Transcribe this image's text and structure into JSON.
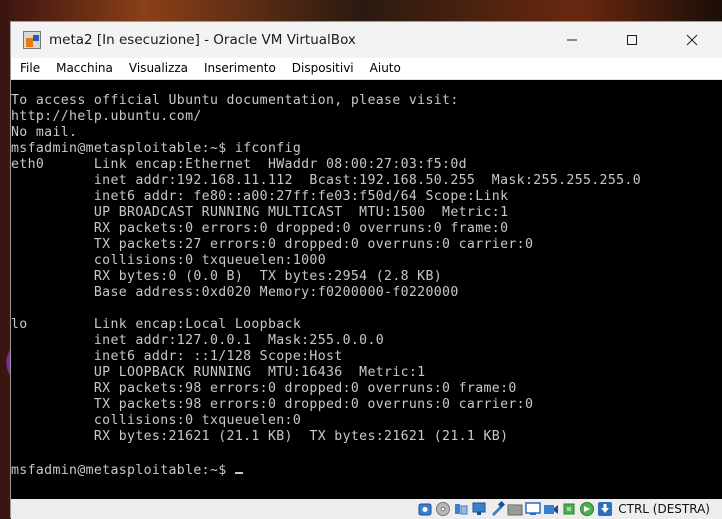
{
  "window": {
    "title": "meta2 [In esecuzione] - Oracle VM VirtualBox"
  },
  "menu": [
    {
      "label": "File"
    },
    {
      "label": "Macchina"
    },
    {
      "label": "Visualizza"
    },
    {
      "label": "Inserimento"
    },
    {
      "label": "Dispositivi"
    },
    {
      "label": "Aiuto"
    }
  ],
  "terminal": {
    "lines": [
      "To access official Ubuntu documentation, please visit:",
      "http://help.ubuntu.com/",
      "No mail.",
      "msfadmin@metasploitable:~$ ifconfig",
      "eth0      Link encap:Ethernet  HWaddr 08:00:27:03:f5:0d",
      "          inet addr:192.168.11.112  Bcast:192.168.50.255  Mask:255.255.255.0",
      "          inet6 addr: fe80::a00:27ff:fe03:f50d/64 Scope:Link",
      "          UP BROADCAST RUNNING MULTICAST  MTU:1500  Metric:1",
      "          RX packets:0 errors:0 dropped:0 overruns:0 frame:0",
      "          TX packets:27 errors:0 dropped:0 overruns:0 carrier:0",
      "          collisions:0 txqueuelen:1000",
      "          RX bytes:0 (0.0 B)  TX bytes:2954 (2.8 KB)",
      "          Base address:0xd020 Memory:f0200000-f0220000",
      "",
      "lo        Link encap:Local Loopback",
      "          inet addr:127.0.0.1  Mask:255.0.0.0",
      "          inet6 addr: ::1/128 Scope:Host",
      "          UP LOOPBACK RUNNING  MTU:16436  Metric:1",
      "          RX packets:98 errors:0 dropped:0 overruns:0 frame:0",
      "          TX packets:98 errors:0 dropped:0 overruns:0 carrier:0",
      "          collisions:0 txqueuelen:0",
      "          RX bytes:21621 (21.1 KB)  TX bytes:21621 (21.1 KB)",
      ""
    ],
    "prompt": "msfadmin@metasploitable:~$ "
  },
  "statusbar": {
    "icons": [
      "hard-disk-icon",
      "optical-drive-icon",
      "audio-icon",
      "network-icon",
      "usb-icon",
      "shared-folders-icon",
      "display-icon",
      "recording-icon",
      "cpu-icon",
      "mouse-integration-icon",
      "keyboard-arrow-icon"
    ],
    "host_key": "CTRL (DESTRA)"
  },
  "colors": {
    "terminal_bg": "#000000",
    "terminal_fg": "#c8c8c8"
  }
}
